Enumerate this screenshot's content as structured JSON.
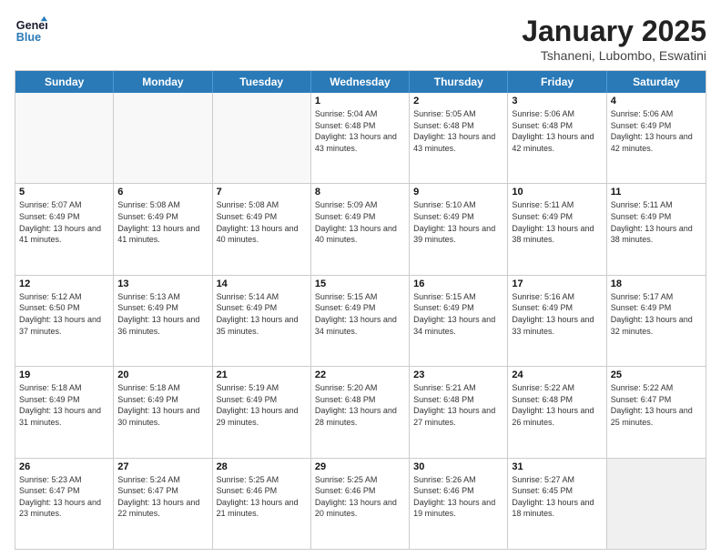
{
  "logo": {
    "line1": "General",
    "line2": "Blue"
  },
  "header": {
    "month_year": "January 2025",
    "location": "Tshaneni, Lubombo, Eswatini"
  },
  "days_of_week": [
    "Sunday",
    "Monday",
    "Tuesday",
    "Wednesday",
    "Thursday",
    "Friday",
    "Saturday"
  ],
  "weeks": [
    [
      {
        "day": "",
        "info": "",
        "empty": true
      },
      {
        "day": "",
        "info": "",
        "empty": true
      },
      {
        "day": "",
        "info": "",
        "empty": true
      },
      {
        "day": "1",
        "info": "Sunrise: 5:04 AM\nSunset: 6:48 PM\nDaylight: 13 hours and 43 minutes."
      },
      {
        "day": "2",
        "info": "Sunrise: 5:05 AM\nSunset: 6:48 PM\nDaylight: 13 hours and 43 minutes."
      },
      {
        "day": "3",
        "info": "Sunrise: 5:06 AM\nSunset: 6:48 PM\nDaylight: 13 hours and 42 minutes."
      },
      {
        "day": "4",
        "info": "Sunrise: 5:06 AM\nSunset: 6:49 PM\nDaylight: 13 hours and 42 minutes."
      }
    ],
    [
      {
        "day": "5",
        "info": "Sunrise: 5:07 AM\nSunset: 6:49 PM\nDaylight: 13 hours and 41 minutes."
      },
      {
        "day": "6",
        "info": "Sunrise: 5:08 AM\nSunset: 6:49 PM\nDaylight: 13 hours and 41 minutes."
      },
      {
        "day": "7",
        "info": "Sunrise: 5:08 AM\nSunset: 6:49 PM\nDaylight: 13 hours and 40 minutes."
      },
      {
        "day": "8",
        "info": "Sunrise: 5:09 AM\nSunset: 6:49 PM\nDaylight: 13 hours and 40 minutes."
      },
      {
        "day": "9",
        "info": "Sunrise: 5:10 AM\nSunset: 6:49 PM\nDaylight: 13 hours and 39 minutes."
      },
      {
        "day": "10",
        "info": "Sunrise: 5:11 AM\nSunset: 6:49 PM\nDaylight: 13 hours and 38 minutes."
      },
      {
        "day": "11",
        "info": "Sunrise: 5:11 AM\nSunset: 6:49 PM\nDaylight: 13 hours and 38 minutes."
      }
    ],
    [
      {
        "day": "12",
        "info": "Sunrise: 5:12 AM\nSunset: 6:50 PM\nDaylight: 13 hours and 37 minutes."
      },
      {
        "day": "13",
        "info": "Sunrise: 5:13 AM\nSunset: 6:49 PM\nDaylight: 13 hours and 36 minutes."
      },
      {
        "day": "14",
        "info": "Sunrise: 5:14 AM\nSunset: 6:49 PM\nDaylight: 13 hours and 35 minutes."
      },
      {
        "day": "15",
        "info": "Sunrise: 5:15 AM\nSunset: 6:49 PM\nDaylight: 13 hours and 34 minutes."
      },
      {
        "day": "16",
        "info": "Sunrise: 5:15 AM\nSunset: 6:49 PM\nDaylight: 13 hours and 34 minutes."
      },
      {
        "day": "17",
        "info": "Sunrise: 5:16 AM\nSunset: 6:49 PM\nDaylight: 13 hours and 33 minutes."
      },
      {
        "day": "18",
        "info": "Sunrise: 5:17 AM\nSunset: 6:49 PM\nDaylight: 13 hours and 32 minutes."
      }
    ],
    [
      {
        "day": "19",
        "info": "Sunrise: 5:18 AM\nSunset: 6:49 PM\nDaylight: 13 hours and 31 minutes."
      },
      {
        "day": "20",
        "info": "Sunrise: 5:18 AM\nSunset: 6:49 PM\nDaylight: 13 hours and 30 minutes."
      },
      {
        "day": "21",
        "info": "Sunrise: 5:19 AM\nSunset: 6:49 PM\nDaylight: 13 hours and 29 minutes."
      },
      {
        "day": "22",
        "info": "Sunrise: 5:20 AM\nSunset: 6:48 PM\nDaylight: 13 hours and 28 minutes."
      },
      {
        "day": "23",
        "info": "Sunrise: 5:21 AM\nSunset: 6:48 PM\nDaylight: 13 hours and 27 minutes."
      },
      {
        "day": "24",
        "info": "Sunrise: 5:22 AM\nSunset: 6:48 PM\nDaylight: 13 hours and 26 minutes."
      },
      {
        "day": "25",
        "info": "Sunrise: 5:22 AM\nSunset: 6:47 PM\nDaylight: 13 hours and 25 minutes."
      }
    ],
    [
      {
        "day": "26",
        "info": "Sunrise: 5:23 AM\nSunset: 6:47 PM\nDaylight: 13 hours and 23 minutes."
      },
      {
        "day": "27",
        "info": "Sunrise: 5:24 AM\nSunset: 6:47 PM\nDaylight: 13 hours and 22 minutes."
      },
      {
        "day": "28",
        "info": "Sunrise: 5:25 AM\nSunset: 6:46 PM\nDaylight: 13 hours and 21 minutes."
      },
      {
        "day": "29",
        "info": "Sunrise: 5:25 AM\nSunset: 6:46 PM\nDaylight: 13 hours and 20 minutes."
      },
      {
        "day": "30",
        "info": "Sunrise: 5:26 AM\nSunset: 6:46 PM\nDaylight: 13 hours and 19 minutes."
      },
      {
        "day": "31",
        "info": "Sunrise: 5:27 AM\nSunset: 6:45 PM\nDaylight: 13 hours and 18 minutes."
      },
      {
        "day": "",
        "info": "",
        "empty": true,
        "shaded": true
      }
    ]
  ]
}
